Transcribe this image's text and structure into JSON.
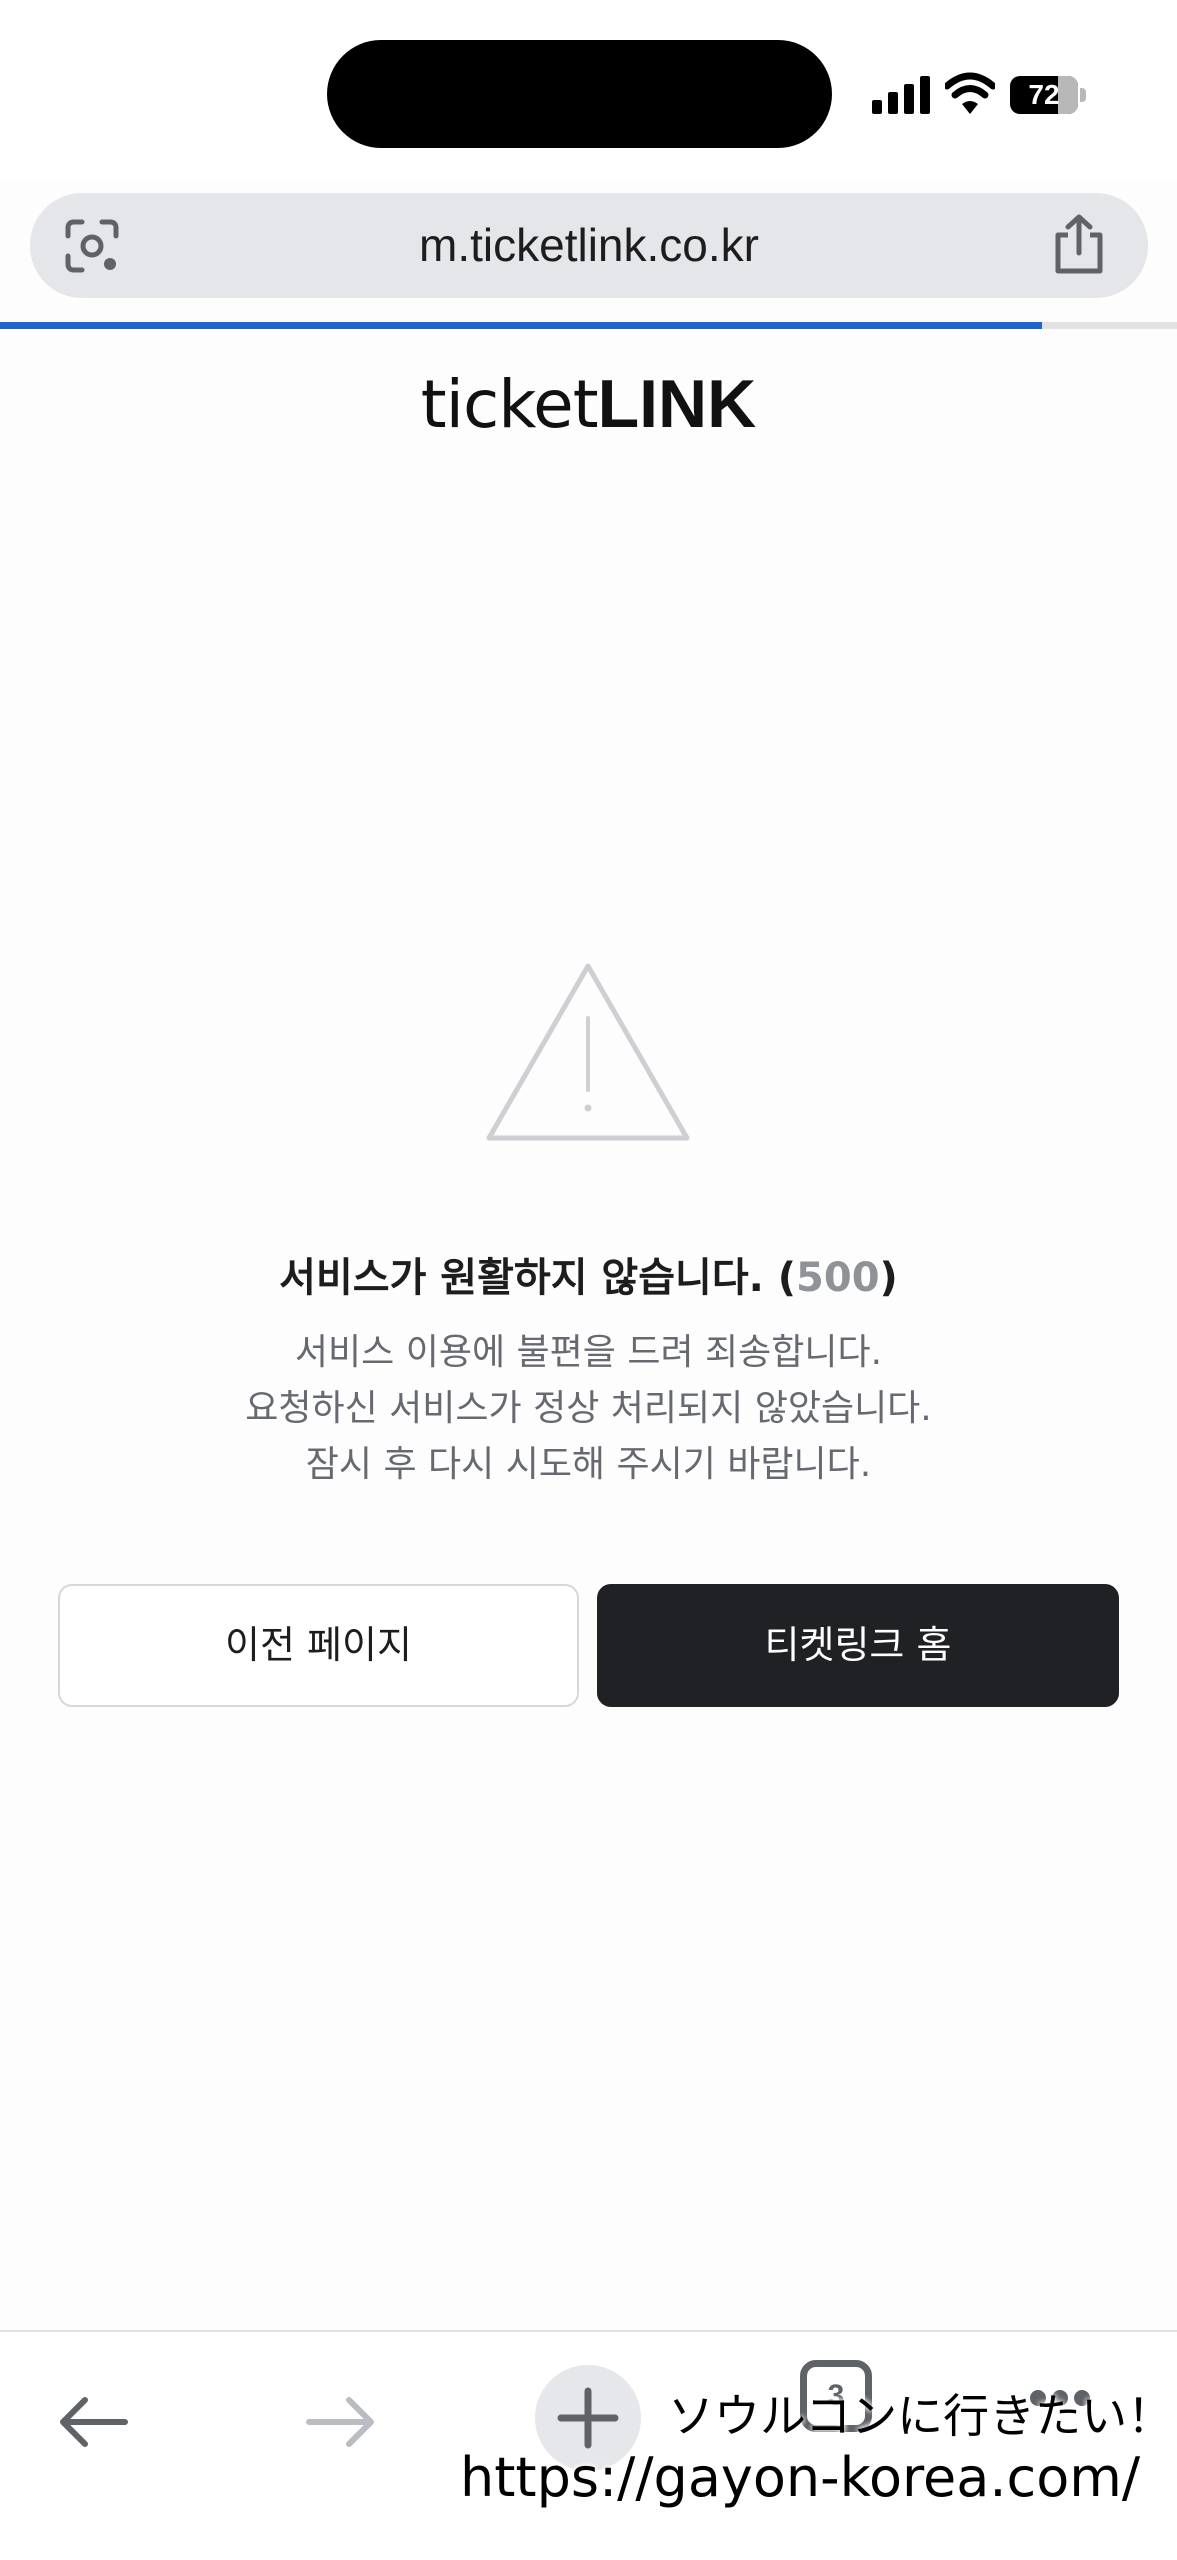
{
  "status_bar": {
    "battery": "72"
  },
  "browser": {
    "url": "m.ticketlink.co.kr",
    "progress": 0.885,
    "lens_icon": "camera-lens-icon",
    "share_icon": "share-icon"
  },
  "logo": {
    "light": "ticket",
    "bold": "LINK"
  },
  "error": {
    "icon": "warning-icon",
    "title": "서비스가 원활하지 않습니다. (",
    "code": "500",
    "title_close": ")",
    "lines": [
      "서비스 이용에 불편을 드려 죄송합니다.",
      "요청하신 서비스가 정상 처리되지 않았습니다.",
      "잠시 후 다시 시도해 주시기 바랍니다."
    ]
  },
  "buttons": {
    "previous": "이전 페이지",
    "home": "티켓링크 홈"
  },
  "toolbar": {
    "tab_count": "3"
  },
  "watermark": {
    "jp": "ソウルコンに行きたい！",
    "url": "https://gayon-korea.com/"
  },
  "colors": {
    "progress": "#1a66c9",
    "primary_button": "#202124"
  }
}
